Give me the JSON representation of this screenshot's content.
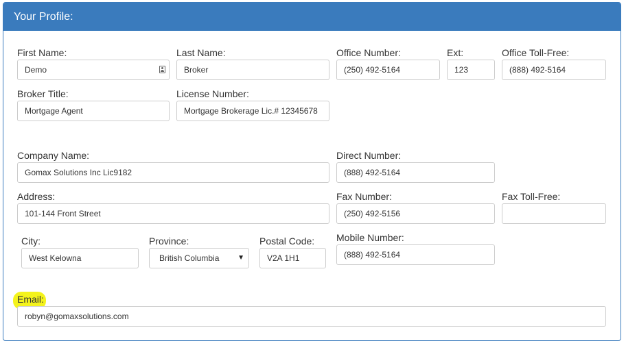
{
  "header": {
    "title": "Your Profile:"
  },
  "fields": {
    "first_name": {
      "label": "First Name:",
      "value": "Demo"
    },
    "last_name": {
      "label": "Last Name:",
      "value": "Broker"
    },
    "office_number": {
      "label": "Office Number:",
      "value": "(250) 492-5164"
    },
    "ext": {
      "label": "Ext:",
      "value": "123"
    },
    "office_toll_free": {
      "label": "Office Toll-Free:",
      "value": "(888) 492-5164"
    },
    "broker_title": {
      "label": "Broker Title:",
      "value": "Mortgage Agent"
    },
    "license_number": {
      "label": "License Number:",
      "value": "Mortgage Brokerage Lic.# 12345678"
    },
    "company_name": {
      "label": "Company Name:",
      "value": "Gomax Solutions Inc  Lic9182"
    },
    "direct_number": {
      "label": "Direct Number:",
      "value": "(888) 492-5164"
    },
    "address": {
      "label": "Address:",
      "value": "101-144 Front Street"
    },
    "fax_number": {
      "label": "Fax Number:",
      "value": "(250) 492-5156"
    },
    "fax_toll_free": {
      "label": "Fax Toll-Free:",
      "value": ""
    },
    "city": {
      "label": "City:",
      "value": "West Kelowna"
    },
    "province": {
      "label": "Province:",
      "value": "British Columbia"
    },
    "postal_code": {
      "label": "Postal Code:",
      "value": "V2A 1H1"
    },
    "mobile_number": {
      "label": "Mobile Number:",
      "value": "(888) 492-5164"
    },
    "email": {
      "label": "Email:",
      "value": "robyn@gomaxsolutions.com"
    }
  },
  "colors": {
    "header_bg": "#3a7bbd",
    "highlight": "#f4f31c",
    "border": "#cccccc"
  },
  "icons": {
    "contact_card": "contact-card-icon",
    "select_caret": "caret-down-icon"
  }
}
